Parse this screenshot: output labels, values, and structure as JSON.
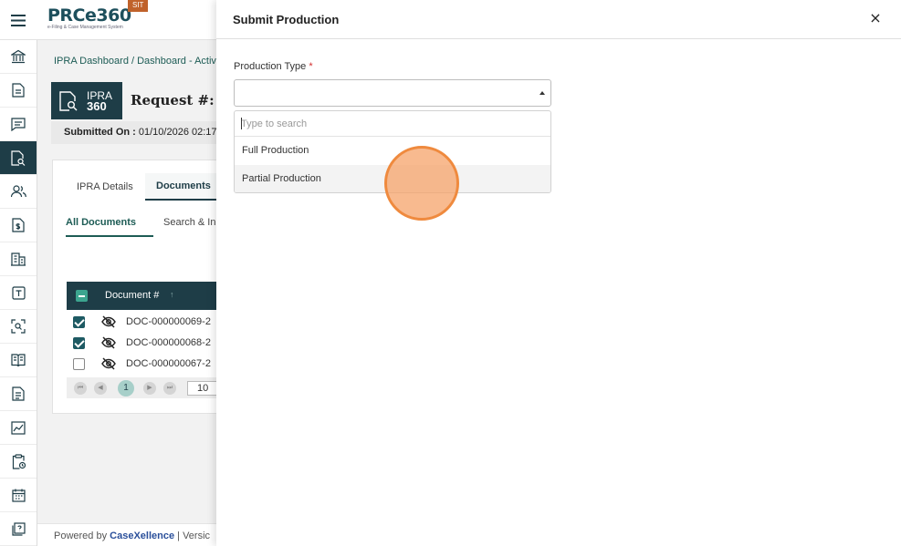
{
  "app": {
    "logo_text": "PRCe360",
    "logo_tagline": "e-Filing & Case Management System",
    "env_badge": "SIT"
  },
  "sidebar": {
    "items": [
      {
        "icon": "bank-icon"
      },
      {
        "icon": "document-icon"
      },
      {
        "icon": "chat-icon"
      },
      {
        "icon": "document-search-icon",
        "active": true
      },
      {
        "icon": "users-icon"
      },
      {
        "icon": "dollar-document-icon"
      },
      {
        "icon": "building-icon"
      },
      {
        "icon": "template-icon"
      },
      {
        "icon": "scan-search-icon"
      },
      {
        "icon": "book-icon"
      },
      {
        "icon": "file-icon"
      },
      {
        "icon": "chart-icon"
      },
      {
        "icon": "clipboard-clock-icon"
      },
      {
        "icon": "calendar-icon"
      },
      {
        "icon": "help-icon"
      }
    ]
  },
  "background": {
    "breadcrumb": "IPRA Dashboard / Dashboard - Activ",
    "badge_top": "IPRA",
    "badge_bottom": "360",
    "request_title": "Request #: IPI",
    "submitted_label": "Submitted On :",
    "submitted_value": "01/10/2026 02:17",
    "tabs": [
      "IPRA Details",
      "Documents"
    ],
    "subtabs": [
      "All Documents",
      "Search & In"
    ],
    "table_header": "Document #",
    "sort_glyph": "↑",
    "rows": [
      {
        "doc": "DOC-000000069-2",
        "checked": true
      },
      {
        "doc": "DOC-000000068-2",
        "checked": true
      },
      {
        "doc": "DOC-000000067-2",
        "checked": false
      }
    ],
    "pager": {
      "current_page": "1",
      "page_size": "10"
    },
    "footer_powered": "Powered by",
    "footer_brand": "CaseXellence",
    "footer_version": "|  Versic"
  },
  "drawer": {
    "title": "Submit Production",
    "close_glyph": "×",
    "field_label": "Production Type",
    "required_mark": "*",
    "search_placeholder": "Type to search",
    "options": [
      "Full Production",
      "Partial Production"
    ],
    "hovered_option": "Partial Production"
  },
  "colors": {
    "primary_dark": "#1e3d47",
    "accent_teal": "#1d5c55",
    "click_indicator": "#ef8a3e",
    "env_badge": "#c0622b"
  }
}
